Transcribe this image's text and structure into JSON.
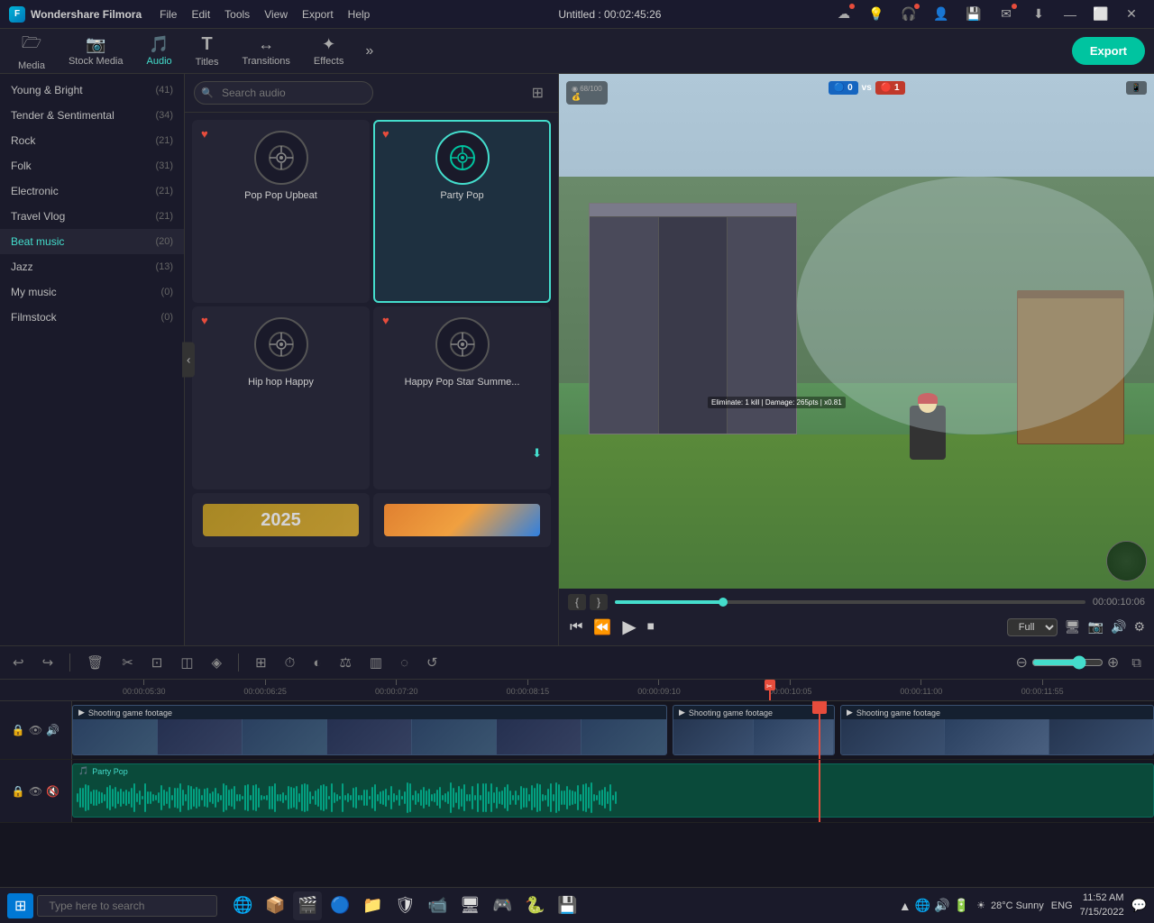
{
  "app": {
    "name": "Wondershare Filmora",
    "title": "Untitled : 00:02:45:26"
  },
  "titlebar": {
    "menu": [
      "File",
      "Edit",
      "Tools",
      "View",
      "Export",
      "Help"
    ],
    "win_controls": [
      "—",
      "⬜",
      "✕"
    ]
  },
  "toolbar": {
    "items": [
      {
        "id": "media",
        "label": "Media",
        "icon": "🗁"
      },
      {
        "id": "stock_media",
        "label": "Stock Media",
        "icon": "📷"
      },
      {
        "id": "audio",
        "label": "Audio",
        "icon": "🎵"
      },
      {
        "id": "titles",
        "label": "Titles",
        "icon": "T"
      },
      {
        "id": "transitions",
        "label": "Transitions",
        "icon": "↔"
      },
      {
        "id": "effects",
        "label": "Effects",
        "icon": "✦"
      }
    ],
    "active": "audio",
    "export_label": "Export"
  },
  "audio_categories": [
    {
      "name": "Young & Bright",
      "count": 41
    },
    {
      "name": "Tender & Sentimental",
      "count": 34
    },
    {
      "name": "Rock",
      "count": 21
    },
    {
      "name": "Folk",
      "count": 31
    },
    {
      "name": "Electronic",
      "count": 21
    },
    {
      "name": "Travel Vlog",
      "count": 21
    },
    {
      "name": "Beat music",
      "count": 20
    },
    {
      "name": "Jazz",
      "count": 13
    },
    {
      "name": "My music",
      "count": 0
    },
    {
      "name": "Filmstock",
      "count": 0
    }
  ],
  "audio_library": {
    "search_placeholder": "Search audio",
    "active_category": "Beat music",
    "items": [
      {
        "id": 1,
        "name": "Pop Pop Upbeat",
        "favorited": true,
        "selected": false
      },
      {
        "id": 2,
        "name": "Party Pop",
        "favorited": true,
        "selected": true
      },
      {
        "id": 3,
        "name": "Hip hop Happy",
        "favorited": true,
        "selected": false
      },
      {
        "id": 4,
        "name": "Happy Pop Star Summe...",
        "favorited": true,
        "selected": false,
        "has_download": true
      }
    ]
  },
  "preview": {
    "progress_percent": 23,
    "time_current": "00:00:10:06",
    "quality": "Full",
    "bracket_left": "{",
    "bracket_right": "}"
  },
  "edit_toolbar": {
    "tools": [
      "↩",
      "↪",
      "🗑",
      "✂",
      "⚙",
      "☆",
      "◎",
      "⊞",
      "⏱",
      "◈",
      "⚖",
      "▥",
      "◐",
      "↺"
    ]
  },
  "timeline": {
    "ruler_marks": [
      {
        "label": "00:00:05:30",
        "pos_pct": 5
      },
      {
        "label": "00:00:06:25",
        "pos_pct": 17
      },
      {
        "label": "00:00:07:20",
        "pos_pct": 30
      },
      {
        "label": "00:00:08:15",
        "pos_pct": 43
      },
      {
        "label": "00:00:09:10",
        "pos_pct": 56
      },
      {
        "label": "00:00:10:05",
        "pos_pct": 69
      },
      {
        "label": "00:00:11:00",
        "pos_pct": 82
      },
      {
        "label": "00:00:11:55",
        "pos_pct": 94
      }
    ],
    "playhead_pos_pct": 69,
    "video_track": {
      "clips": [
        {
          "label": "Shooting game footage",
          "left_pct": 0,
          "width_pct": 55,
          "icon": "▶"
        },
        {
          "label": "Shooting game footage",
          "left_pct": 55,
          "width_pct": 27,
          "icon": "▶"
        },
        {
          "label": "Shooting game footage",
          "left_pct": 72,
          "width_pct": 28,
          "icon": "▶"
        }
      ]
    },
    "audio_track": {
      "name": "Party Pop",
      "left_pct": 0,
      "width_pct": 100
    }
  },
  "taskbar": {
    "search_placeholder": "Type here to search",
    "apps": [
      "🌀",
      "📦",
      "🔶",
      "🌐",
      "📁",
      "🛡",
      "📹",
      "🖥",
      "💿",
      "🔵",
      "🎮"
    ],
    "weather": "28°C  Sunny",
    "time": "11:52 AM",
    "date": "7/15/2022",
    "language": "ENG"
  },
  "colors": {
    "accent": "#00c4a0",
    "playhead": "#e74c3c",
    "selected_border": "#00c4a0",
    "audio_track_bg": "#0a4a3a"
  }
}
